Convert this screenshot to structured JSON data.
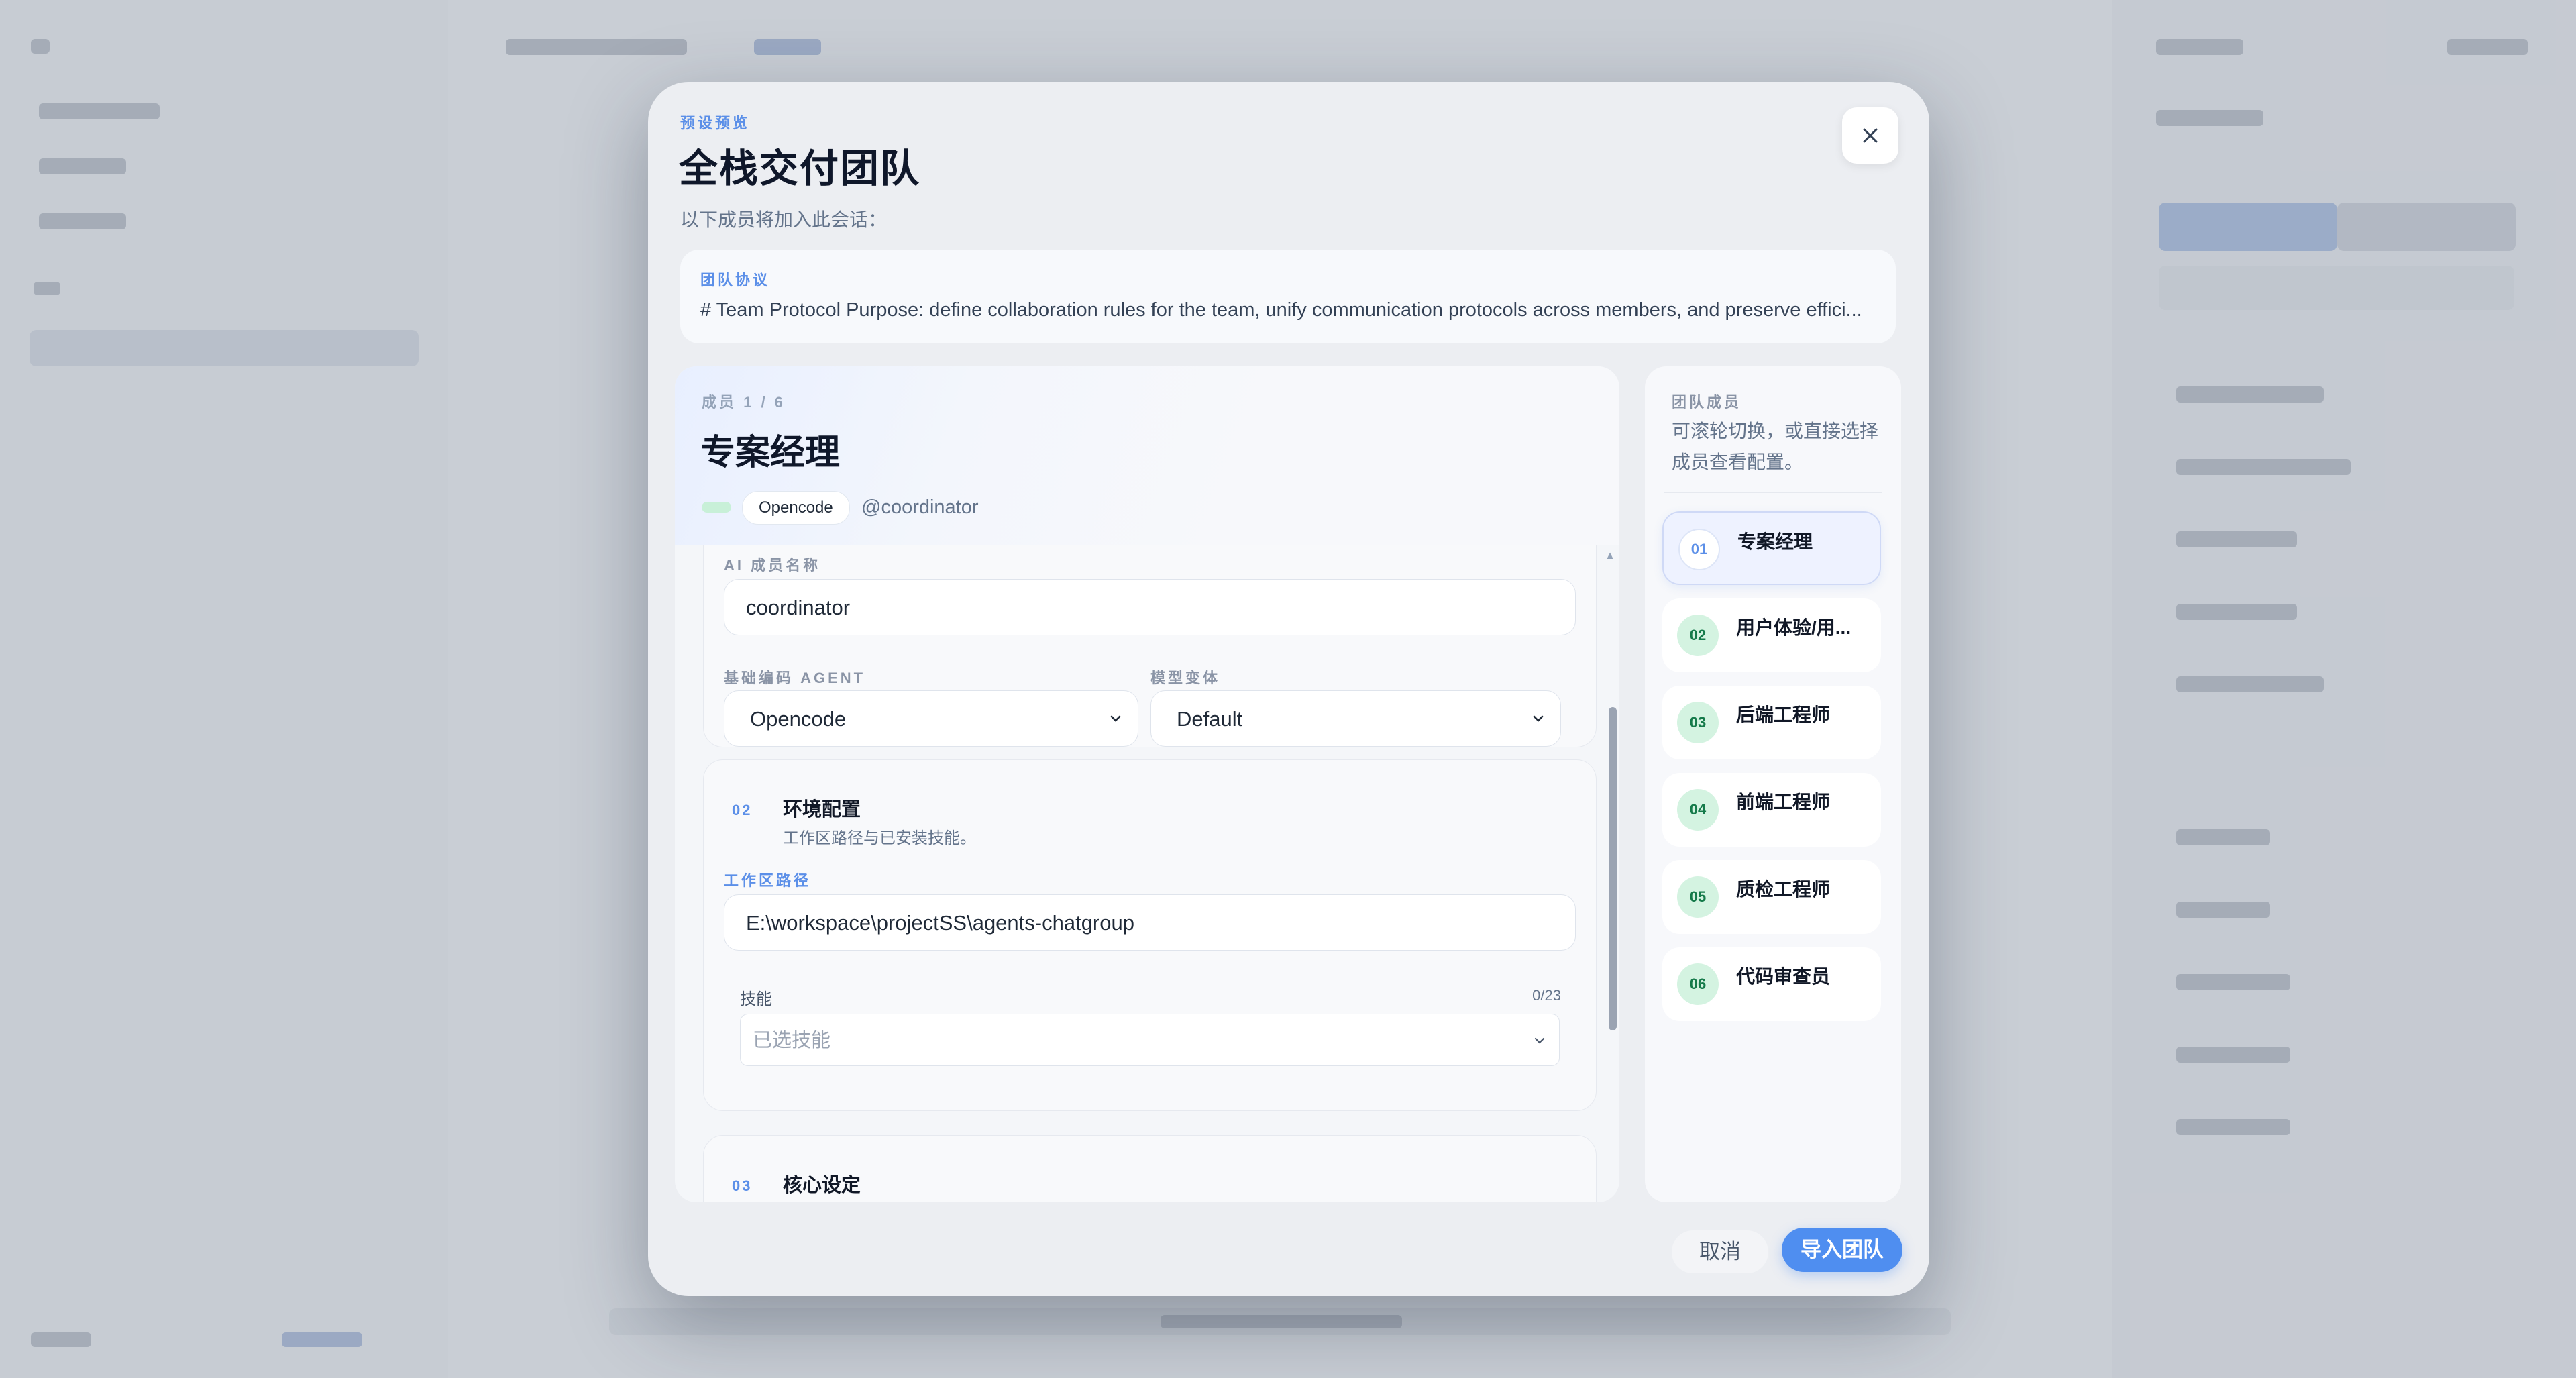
{
  "modal": {
    "eyebrow": "预设预览",
    "title": "全栈交付团队",
    "subtitle": "以下成员将加入此会话："
  },
  "protocol": {
    "label": "团队协议",
    "text": "# Team Protocol Purpose: define collaboration rules for the team, unify communication protocols across members, and preserve effici..."
  },
  "member": {
    "index": "成员 1 / 6",
    "name": "专案经理",
    "agent_tag": "Opencode",
    "handle": "@coordinator"
  },
  "config": {
    "ai_name_label": "AI 成员名称",
    "ai_name_value": "coordinator",
    "agent_label": "基础编码 AGENT",
    "agent_value": "Opencode",
    "variant_label": "模型变体",
    "variant_value": "Default",
    "env": {
      "num": "02",
      "title": "环境配置",
      "desc": "工作区路径与已安装技能。",
      "workspace_label": "工作区路径",
      "workspace_value": "E:\\workspace\\projectSS\\agents-chatgroup",
      "skills_label": "技能",
      "skills_count": "0/23",
      "skills_placeholder": "已选技能"
    },
    "core": {
      "num": "03",
      "title": "核心设定"
    }
  },
  "members": {
    "label": "团队成员",
    "hint": "可滚轮切换，或直接选择成员查看配置。",
    "items": [
      {
        "num": "01",
        "name": "专案经理"
      },
      {
        "num": "02",
        "name": "用户体验/用..."
      },
      {
        "num": "03",
        "name": "后端工程师"
      },
      {
        "num": "04",
        "name": "前端工程师"
      },
      {
        "num": "05",
        "name": "质检工程师"
      },
      {
        "num": "06",
        "name": "代码审查员"
      }
    ]
  },
  "footer": {
    "cancel": "取消",
    "import": "导入团队"
  },
  "icons": {
    "close": "close-icon",
    "chevron": "chevron-down-icon"
  },
  "colors": {
    "accent": "#4f8ef0",
    "label_blue": "#5b8fe8",
    "badge_green": "#d4f3e1"
  }
}
